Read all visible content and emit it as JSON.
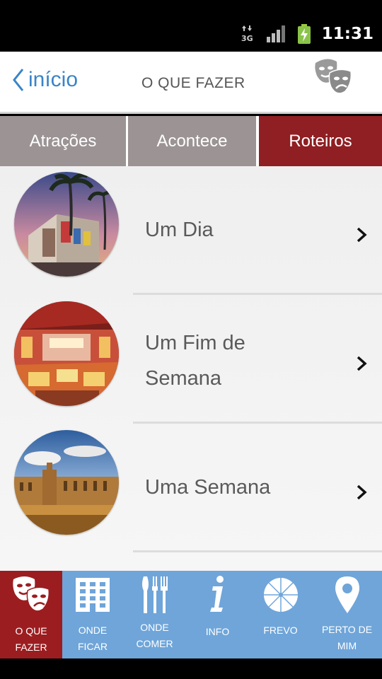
{
  "status_bar": {
    "time": "11:31",
    "network": "3G"
  },
  "header": {
    "back_label": "início",
    "title": "O QUE FAZER"
  },
  "tabs": [
    {
      "label": "Atrações",
      "active": false
    },
    {
      "label": "Acontece",
      "active": false
    },
    {
      "label": "Roteiros",
      "active": true
    }
  ],
  "list": {
    "items": [
      {
        "label": "Um Dia"
      },
      {
        "label": "Um Fim de Semana"
      },
      {
        "label": "Uma Semana"
      }
    ]
  },
  "bottom_nav": {
    "items": [
      {
        "label": "O QUE FAZER",
        "icon": "masks-icon",
        "active": true
      },
      {
        "label": "ONDE FICAR",
        "icon": "building-icon",
        "active": false
      },
      {
        "label": "ONDE COMER",
        "icon": "cutlery-icon",
        "active": false
      },
      {
        "label": "INFO",
        "icon": "info-icon",
        "active": false
      },
      {
        "label": "FREVO",
        "icon": "umbrella-icon",
        "active": false
      },
      {
        "label": "PERTO DE MIM",
        "icon": "location-pin-icon",
        "active": false
      }
    ]
  },
  "colors": {
    "accent_red": "#8f1f22",
    "tab_gray": "#9c9494",
    "nav_blue": "#6fa5d9",
    "link_blue": "#3a84c7"
  }
}
